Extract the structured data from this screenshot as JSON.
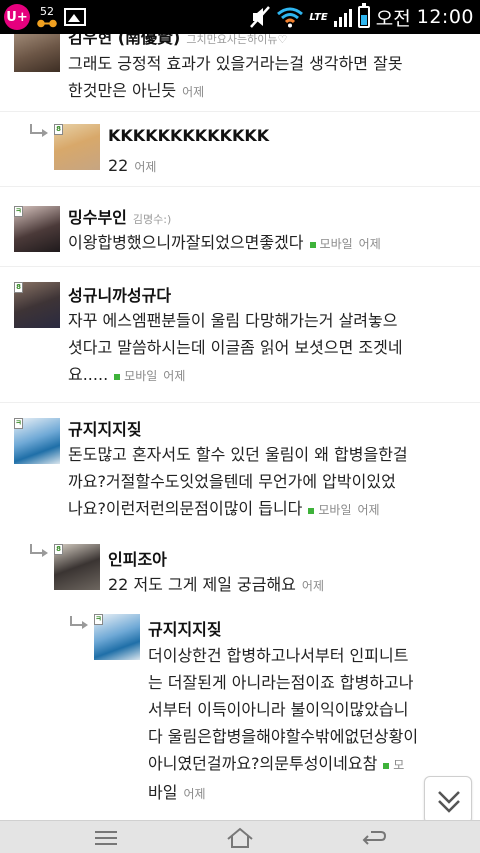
{
  "status_bar": {
    "carrier_logo": "U+",
    "badge_number": "52",
    "network_label": "LTE",
    "ampm": "오전",
    "time": "12:00",
    "icons": [
      "uplus-logo",
      "glasses-badge-icon",
      "image-icon",
      "mute-icon",
      "wifi-icon",
      "lte-icon",
      "signal-icon",
      "battery-icon"
    ]
  },
  "comments": [
    {
      "name": "김우현 (南優賢)",
      "subname": "그치만요사는하이뉴♡",
      "lines": [
        "그래도 긍정적 효과가 있을거라는걸 생각하면 잘못",
        "한것만은 아닌듯"
      ],
      "time": "어제"
    },
    {
      "name": "KKKKKKKKKKKKK",
      "lines": [
        "22"
      ],
      "time": "어제"
    },
    {
      "name": "밍수부인",
      "subname": "김명수:)",
      "lines": [
        "이왕합병했으니까잘되었으면좋겠다"
      ],
      "mobile": "모바일",
      "time": "어제"
    },
    {
      "name": "성규니까성규다",
      "lines": [
        "자꾸 에스엠팬분들이 울림 다망해가는거 살려놓으",
        "셧다고 말씀하시는데 이글좀 읽어 보셧으면 조겟네",
        "요....."
      ],
      "mobile": "모바일",
      "time": "어제"
    },
    {
      "name": "규지지지짖",
      "lines": [
        "돈도많고 혼자서도 할수 있던 울림이 왜 합병을한걸",
        "까요?거절할수도잇었을텐데 무언가에 압박이있었",
        "나요?이런저런의문점이많이 듭니다"
      ],
      "mobile": "모바일",
      "time": "어제"
    },
    {
      "name": "인피조아",
      "lines": [
        "22 저도 그게 제일 궁금해요"
      ],
      "time": "어제"
    },
    {
      "name": "규지지지짖",
      "lines": [
        "더이상한건 합병하고나서부터 인피니트",
        "는 더잘된게 아니라는점이죠 합병하고나",
        "서부터 이득이아니라 불이익이많았습니",
        "다 울림은합병을해야할수밖에없던상황이",
        "아니였던걸까요?의문투성이네요참",
        "바일"
      ],
      "mobile": "모",
      "time": "어제"
    }
  ],
  "nav": {
    "menu_icon": "menu-icon",
    "home_icon": "home-icon",
    "back_icon": "back-icon",
    "scroll_icon": "double-chevron-down-icon"
  }
}
